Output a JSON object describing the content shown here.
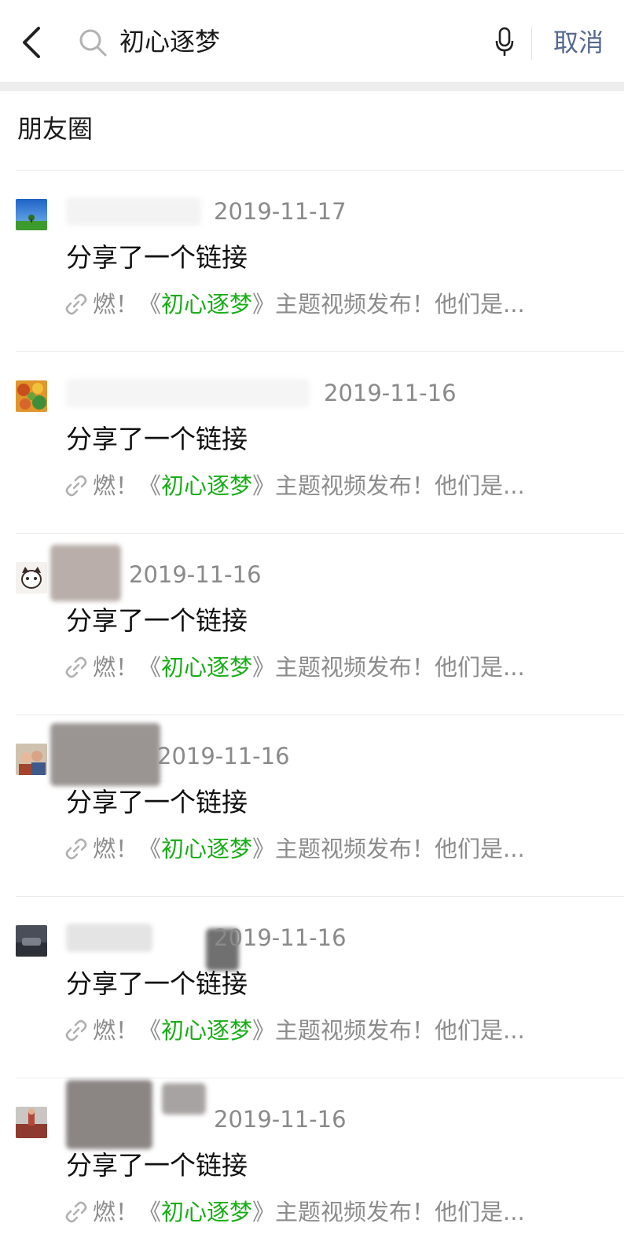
{
  "search": {
    "query": "初心逐梦",
    "cancel_label": "取消"
  },
  "section": {
    "title": "朋友圈"
  },
  "colors": {
    "highlight": "#1aad19",
    "cancel": "#56698f",
    "secondary_text": "#8a8a8a"
  },
  "icons": {
    "back": "chevron-left-icon",
    "search": "search-icon",
    "mic": "microphone-icon",
    "link": "link-icon"
  },
  "results": [
    {
      "date": "2019-11-17",
      "title": "分享了一个链接",
      "link_prefix": "燃！《",
      "link_highlight": "初心逐梦",
      "link_suffix": "》主题视频发布！他们是..."
    },
    {
      "date": "2019-11-16",
      "title": "分享了一个链接",
      "link_prefix": "燃！《",
      "link_highlight": "初心逐梦",
      "link_suffix": "》主题视频发布！他们是..."
    },
    {
      "date": "2019-11-16",
      "title": "分享了一个链接",
      "link_prefix": "燃！《",
      "link_highlight": "初心逐梦",
      "link_suffix": "》主题视频发布！他们是..."
    },
    {
      "date": "2019-11-16",
      "title": "分享了一个链接",
      "link_prefix": "燃！《",
      "link_highlight": "初心逐梦",
      "link_suffix": "》主题视频发布！他们是..."
    },
    {
      "date": "2019-11-16",
      "title": "分享了一个链接",
      "link_prefix": "燃！《",
      "link_highlight": "初心逐梦",
      "link_suffix": "》主题视频发布！他们是..."
    },
    {
      "date": "2019-11-16",
      "title": "分享了一个链接",
      "link_prefix": "燃！《",
      "link_highlight": "初心逐梦",
      "link_suffix": "》主题视频发布！他们是..."
    }
  ]
}
